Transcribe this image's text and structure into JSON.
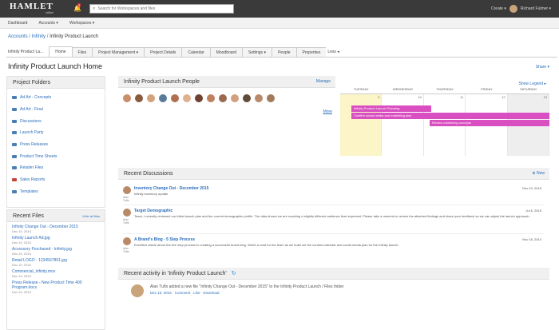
{
  "header": {
    "logo": "HAMLET",
    "logo_sub": "online",
    "notif_count": "3",
    "search_placeholder": "Search for Workspaces and files",
    "create_label": "Create ▾",
    "user_label": "Richard Fulmer ▾"
  },
  "nav": {
    "dashboard": "Dashboard",
    "accounts": "Accounts ▾",
    "workspaces": "Workspaces ▾"
  },
  "breadcrumb": {
    "part1": "Accounts",
    "sep": " / ",
    "part2": "Infinity",
    "part3": "Infinity Product Launch"
  },
  "tabs": {
    "workspace": "Infinity Product La...",
    "items": [
      "Home",
      "Files",
      "Project Management ▾",
      "Project Details",
      "Calendar",
      "Moodboard",
      "Settings ▾",
      "People",
      "Properties",
      "Less ◂"
    ]
  },
  "page": {
    "title": "Infinity Product Launch Home",
    "share": "Share ▾"
  },
  "folders": {
    "title": "Project Folders",
    "items": [
      "Ad Art - Concepts",
      "Ad Art - Final",
      "Discussions",
      "Launch Party",
      "Press Releases",
      "Product Time Sheets",
      "Retailer Files",
      "Sales Reports",
      "Templates"
    ]
  },
  "recent_files": {
    "title": "Recent Files",
    "link": "Hide all files",
    "items": [
      {
        "name": "Infinity Change Out - December 2015",
        "date": "Dec 10, 2015"
      },
      {
        "name": "Infinity Launch Ad.jpg",
        "date": "Dec 10, 2015"
      },
      {
        "name": "Accessory Purchased - Infinity.jpg",
        "date": "Dec 10, 2015"
      },
      {
        "name": "Retail LOGO - 1234567891.jpg",
        "date": "Dec 10, 2015"
      },
      {
        "name": "Commercial_Infinity.mov",
        "date": "Dec 10, 2015"
      },
      {
        "name": "Press Release - New Product Time 400 Program.docx",
        "date": "Dec 10, 2015"
      }
    ]
  },
  "people": {
    "title": "Infinity Product Launch People",
    "manage": "Manage",
    "more": "More",
    "colors": [
      "#c98e6a",
      "#8a5a3c",
      "#d4a27c",
      "#5a7a9a",
      "#b07050",
      "#e0b090",
      "#704030",
      "#c08060",
      "#9a6a50",
      "#d0a080",
      "#604a3a",
      "#b88a6a",
      "#a07a5a"
    ]
  },
  "calendar": {
    "show_legend": "Show Legend ▸",
    "days": [
      "TUESDAY",
      "WEDNESDAY",
      "THURSDAY",
      "FRIDAY",
      "SATURDAY"
    ],
    "dates": [
      "9",
      "10",
      "11",
      "12",
      "13"
    ],
    "events": [
      "Infinity Product Launch Planning",
      "Confirm social media and marketing plan",
      "Review marketing concepts"
    ],
    "event_color": "#d94fc1"
  },
  "discussions": {
    "title": "Recent Discussions",
    "new": "New",
    "items": [
      {
        "title": "Inventory Change Out - December 2015",
        "body": "Infinity inventory update",
        "date": "Dec 10, 2015",
        "user": "Alan Tufts"
      },
      {
        "title": "Target Demographic",
        "body": "Team, I recently reviewed our initial launch plan and the current demographic profile. The data shows we are reaching a slightly different audience than expected. Please take a moment to review the attached findings and share your feedback so we can adjust the launch approach.",
        "date": "Jul 6, 2015",
        "user": "Alan Tufts"
      },
      {
        "title": "A Brand's Blog - 5 Step Process",
        "body": "Excellent article about the five step process to creating a successful brand blog. Worth a read for the team as we build out the content calendar and social media plan for the Infinity launch.",
        "date": "Nov 16, 2014",
        "user": "Alan Tufts"
      }
    ]
  },
  "activity": {
    "title": "Recent activity in 'Infinity Product Launch'",
    "line1": "Alan Tufts added a new file \"Infinity Change Out - December 2015\" to the Infinity Product Launch / Files folder",
    "line2": "Dec 10, 2015 · Comment · Like · Download"
  }
}
